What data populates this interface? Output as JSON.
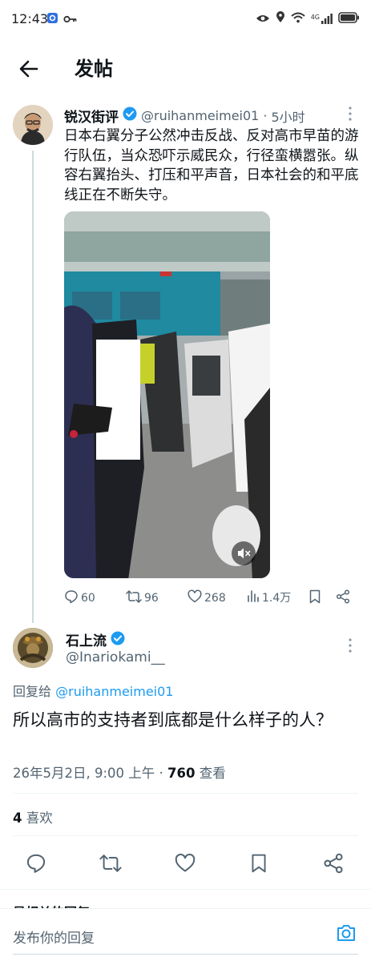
{
  "status_bar": {
    "time": "12:43",
    "network": "4G"
  },
  "header": {
    "title": "发帖"
  },
  "post1": {
    "author_name": "锐汉街评",
    "handle": "@ruihanmeimei01",
    "time_separator": "·",
    "time": "5小时",
    "body": "日本右翼分子公然冲击反战、反对高市早苗的游行队伍，当众恐吓示威民众，行径蛮横嚣张。纵容右翼抬头、打压和平声音，日本社会的和平底线正在不断失守。",
    "stats": {
      "replies": "60",
      "reposts": "96",
      "likes": "268",
      "views": "1.4万"
    }
  },
  "post2": {
    "author_name": "石上流",
    "handle": "@Inariokami__",
    "reply_prefix": "回复给",
    "reply_target": "@ruihanmeimei01",
    "body": "所以高市的支持者到底都是什么样子的人？",
    "date": "26年5月2日, 9:00 上午 · ",
    "views_count": "760",
    "views_label": " 查看",
    "likes_count": "4",
    "likes_label": " 喜欢"
  },
  "related_heading": "最相关的回复",
  "compose": {
    "placeholder": "发布你的回复"
  },
  "colors": {
    "accent": "#1d9bf0",
    "text": "#0f1419",
    "muted": "#536471",
    "divider": "#eff3f4"
  },
  "icons": [
    "back-arrow-icon",
    "verified-badge-icon",
    "more-icon",
    "reply-icon",
    "repost-icon",
    "like-icon",
    "views-icon",
    "bookmark-icon",
    "share-icon",
    "mute-icon",
    "camera-icon"
  ]
}
